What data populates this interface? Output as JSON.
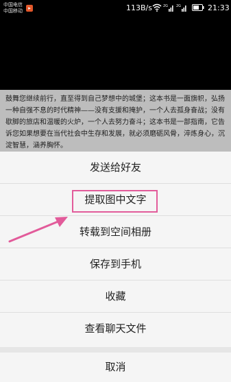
{
  "status_bar": {
    "carrier_1": "中国电信",
    "carrier_2": "中国移动",
    "network_speed": "113B/s",
    "sim_1_label": "2G",
    "sim_2_label": "2G",
    "time": "21:33"
  },
  "photo": {
    "text": "鼓舞您继续前行，直至得到自己梦想中的城堡；这本书是一面旗帜，弘扬一种自强不息的时代精神——没有支援和掩护，一个人去孤身奋战；没有歇脚的旅店和温暖的火炉，一个人去努力奋斗；这本书是一部指南，它告诉您如果想要在当代社会中生存和发展，就必须磨砺风骨，淬炼身心，沉淀智慧，涵养胸怀。"
  },
  "menu": {
    "items": [
      {
        "label": "发送给好友"
      },
      {
        "label": "提取图中文字"
      },
      {
        "label": "转载到空间相册"
      },
      {
        "label": "保存到手机"
      },
      {
        "label": "收藏"
      },
      {
        "label": "查看聊天文件"
      }
    ],
    "cancel_label": "取消"
  },
  "colors": {
    "highlight": "#e25b9a",
    "sheet_background": "#f5f5f5",
    "photo_paper": "#bdbdbd"
  },
  "annotation": {
    "highlighted_item": "提取图中文字"
  }
}
